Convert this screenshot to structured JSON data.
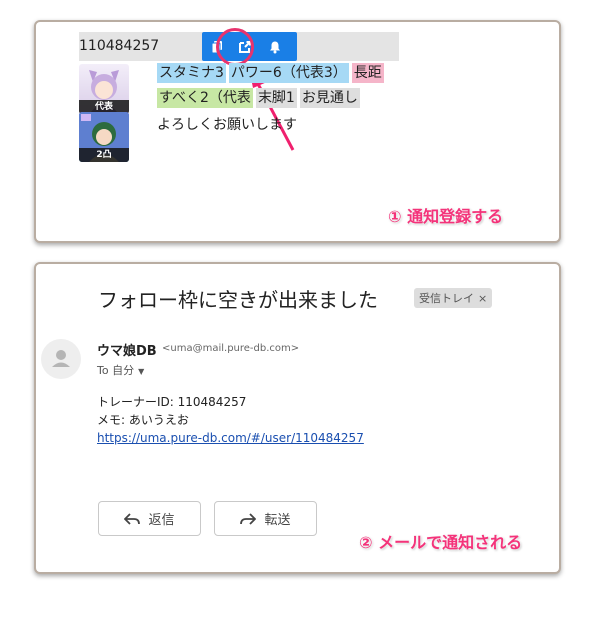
{
  "trainer_card": {
    "trainer_id": "110484257",
    "actions": [
      "copy-icon",
      "open-external-icon",
      "bell-icon"
    ],
    "avatars": [
      {
        "label": "代表"
      },
      {
        "label": "2凸"
      }
    ],
    "skills_line1": [
      "スタミナ3",
      "パワー6（代表3）",
      "長距"
    ],
    "skills_line2": [
      "すべく2（代表",
      "末脚1",
      "お見通し"
    ],
    "memo": "よろしくお願いします",
    "step_label": "① 通知登録する"
  },
  "mail": {
    "subject": "フォロー枠に空きが出来ました",
    "label_chip": "受信トレイ",
    "label_chip_close": "×",
    "sender_name": "ウマ娘DB",
    "sender_email": "<uma@mail.pure-db.com>",
    "to_line": "To 自分",
    "body_line1": "トレーナーID: 110484257",
    "body_line2": "メモ: あいうえお",
    "link": "https://uma.pure-db.com/#/user/110484257",
    "reply_label": "返信",
    "forward_label": "転送",
    "step_label": "② メールで通知される"
  },
  "colors": {
    "accent_blue": "#1a7fe6",
    "highlight_pink": "#e8336d",
    "step_text": "#f4337a"
  }
}
